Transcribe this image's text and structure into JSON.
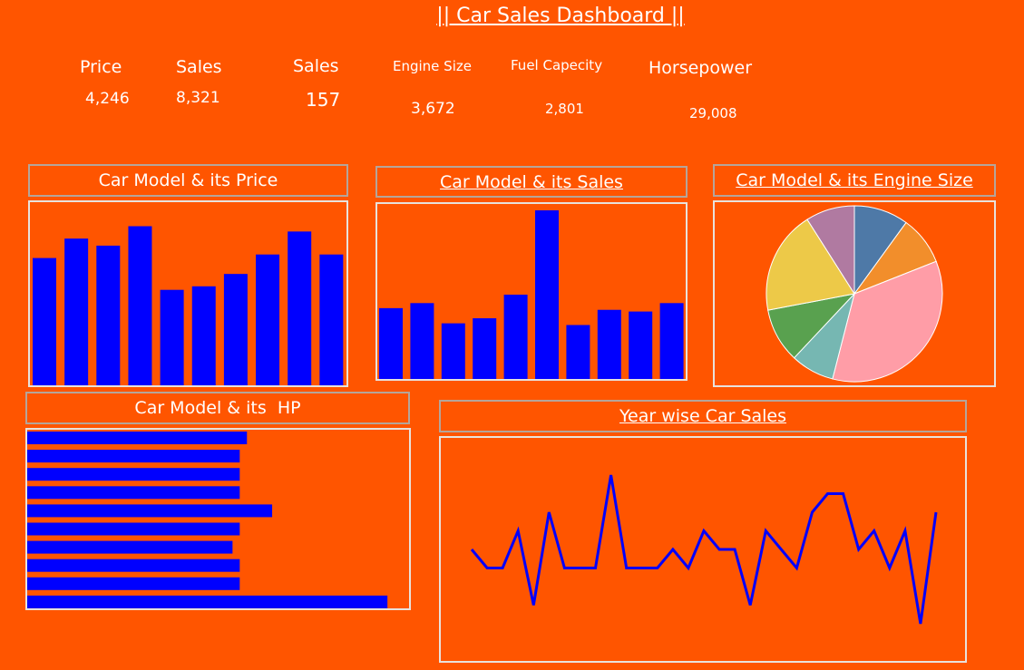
{
  "title": "|| Car Sales Dashboard ||",
  "kpis": [
    {
      "label": "Price",
      "value": "4,246"
    },
    {
      "label": "Sales",
      "value": "8,321"
    },
    {
      "label": "Sales",
      "value": "157"
    },
    {
      "label": "Engine Size",
      "value": "3,672"
    },
    {
      "label": "Fuel Capecity",
      "value": "2,801"
    },
    {
      "label": "Horsepower",
      "value": "29,008"
    }
  ],
  "colors": {
    "background": "#FF5500",
    "bar": "#0000FF",
    "text": "#FFFFFF"
  },
  "chart_data": [
    {
      "type": "bar",
      "title": "Car Model & its Price",
      "orientation": "vertical",
      "values": [
        0.72,
        0.83,
        0.79,
        0.9,
        0.54,
        0.56,
        0.63,
        0.74,
        0.87,
        0.74
      ],
      "ylim": [
        0,
        1
      ]
    },
    {
      "type": "bar",
      "title": "Car Model & its Sales",
      "orientation": "vertical",
      "values": [
        0.42,
        0.45,
        0.33,
        0.36,
        0.5,
        1.0,
        0.32,
        0.41,
        0.4,
        0.45
      ],
      "ylim": [
        0,
        1
      ]
    },
    {
      "type": "pie",
      "title": "Car Model & its Engine Size",
      "values": [
        10,
        9,
        35,
        8,
        10,
        19,
        9
      ],
      "colors": [
        "#4E79A7",
        "#F28E2B",
        "#FF9DA7",
        "#76B7B2",
        "#59A14F",
        "#EDC948",
        "#B07AA1"
      ]
    },
    {
      "type": "bar",
      "title": "Car Model & its  HP",
      "orientation": "horizontal",
      "values": [
        0.61,
        0.59,
        0.59,
        0.59,
        0.68,
        0.59,
        0.57,
        0.59,
        0.59,
        1.0
      ],
      "xlim": [
        0,
        1.05
      ]
    },
    {
      "type": "line",
      "title": "Year wise Car Sales",
      "values": [
        4,
        3,
        3,
        5,
        1,
        6,
        3,
        3,
        3,
        8,
        3,
        3,
        3,
        4,
        3,
        5,
        4,
        4,
        1,
        5,
        4,
        3,
        6,
        7,
        7,
        4,
        5,
        3,
        5,
        0,
        6
      ],
      "ylim": [
        -2,
        10
      ]
    }
  ]
}
